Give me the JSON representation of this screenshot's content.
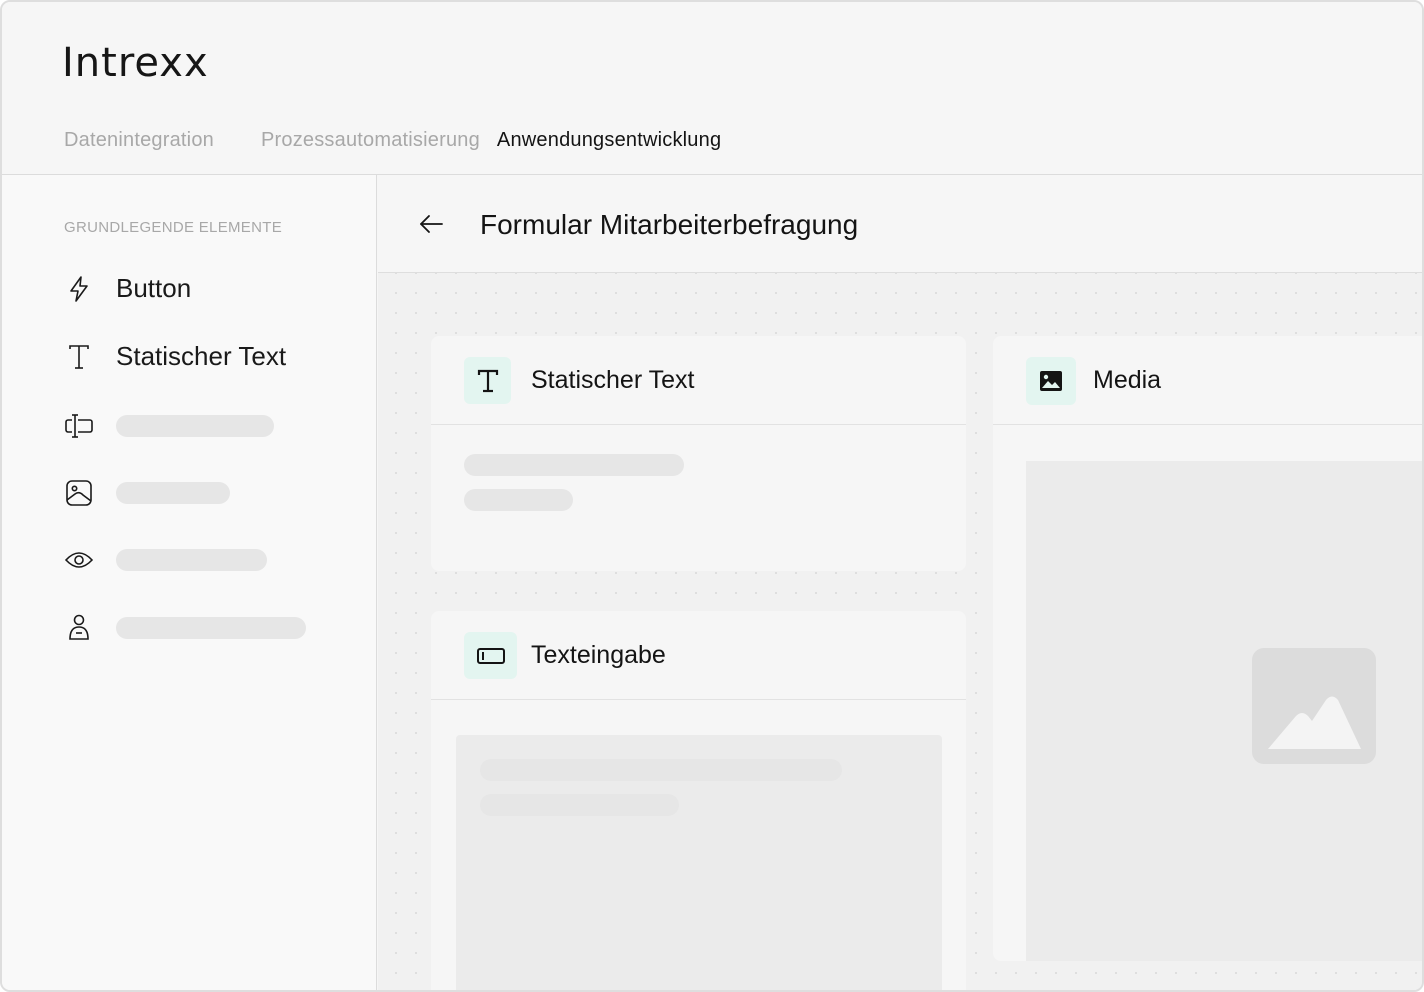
{
  "app": {
    "logo": "Intrexx"
  },
  "nav": {
    "items": [
      "Datenintegration",
      "Prozessautomatisierung",
      "Anwendungsentwicklung"
    ],
    "active_index": 2
  },
  "sidebar": {
    "heading": "GRUNDLEGENDE ELEMENTE",
    "items": [
      {
        "icon": "lightning-icon",
        "label": "Button"
      },
      {
        "icon": "text-t-icon",
        "label": "Statischer Text"
      },
      {
        "icon": "text-input-icon",
        "label": ""
      },
      {
        "icon": "image-icon",
        "label": ""
      },
      {
        "icon": "eye-icon",
        "label": ""
      },
      {
        "icon": "user-icon",
        "label": ""
      }
    ]
  },
  "main": {
    "back_icon": "arrow-left-icon",
    "title": "Formular Mitarbeiterbefragung",
    "cards": [
      {
        "icon": "text-t-icon",
        "title": "Statischer Text"
      },
      {
        "icon": "image-icon",
        "title": "Media"
      },
      {
        "icon": "text-input-icon",
        "title": "Texteingabe"
      }
    ]
  },
  "colors": {
    "accent_bg": "#e3f5f0",
    "text": "#141414",
    "muted": "#a8a8a8",
    "skeleton": "#e6e6e6"
  }
}
